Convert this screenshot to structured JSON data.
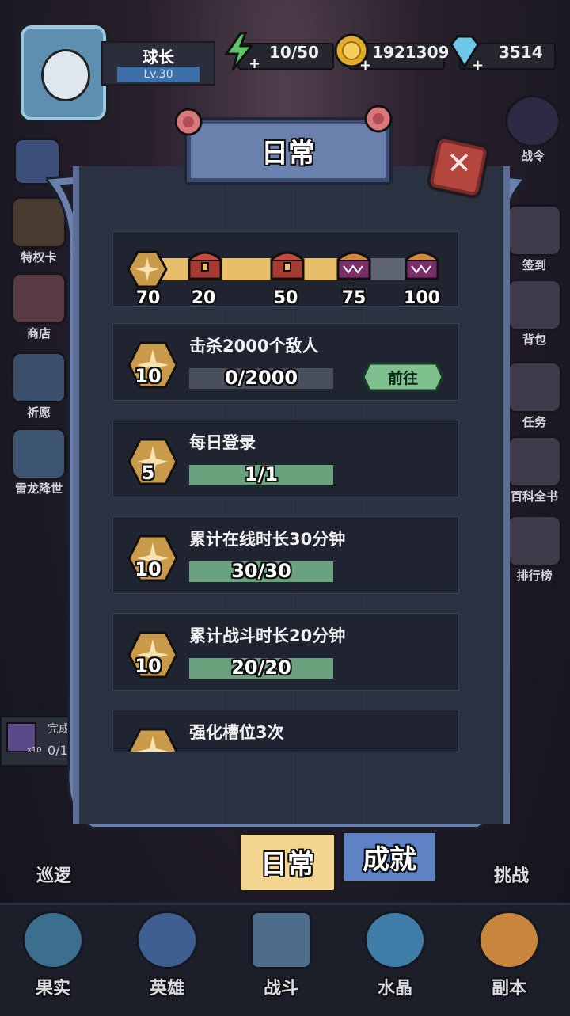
{
  "header": {
    "player_name": "球长",
    "level": "Lv.30",
    "energy": "10/50",
    "gold": "1921309",
    "gems": "3514"
  },
  "left_menu": [
    {
      "label": "特权卡",
      "icon": "card-icon"
    },
    {
      "label": "商店",
      "icon": "shop-icon"
    },
    {
      "label": "祈愿",
      "icon": "wish-icon"
    },
    {
      "label": "雷龙降世",
      "icon": "dragon-icon"
    }
  ],
  "right_menu": [
    {
      "label": "战令",
      "icon": "eye-icon"
    },
    {
      "label": "签到",
      "icon": "signin-icon"
    },
    {
      "label": "背包",
      "icon": "bag-icon"
    },
    {
      "label": "任务",
      "icon": "task-icon"
    },
    {
      "label": "百科全书",
      "icon": "book-icon"
    },
    {
      "label": "排行榜",
      "icon": "rank-icon"
    }
  ],
  "side_quest": {
    "label": "完成",
    "count": "0/1",
    "multiplier": "x10"
  },
  "panel": {
    "title": "日常",
    "close_icon": "close-icon",
    "activity": {
      "current": "70",
      "milestones": [
        "20",
        "50",
        "75",
        "100"
      ],
      "progress_fraction": 0.7
    },
    "tasks": [
      {
        "name": "击杀2000个敌人",
        "reward": "10",
        "progress": "0/2000",
        "fill": 0.0,
        "action": "前往"
      },
      {
        "name": "每日登录",
        "reward": "5",
        "progress": "1/1",
        "fill": 1.0
      },
      {
        "name": "累计在线时长30分钟",
        "reward": "10",
        "progress": "30/30",
        "fill": 1.0
      },
      {
        "name": "累计战斗时长20分钟",
        "reward": "10",
        "progress": "20/20",
        "fill": 1.0
      },
      {
        "name": "强化槽位3次",
        "reward": "",
        "progress": "",
        "fill": 0.0
      }
    ]
  },
  "tabs": {
    "daily": "日常",
    "achievement": "成就"
  },
  "side_bottom": {
    "patrol": "巡逻",
    "challenge": "挑战"
  },
  "nav": [
    "果实",
    "英雄",
    "战斗",
    "水晶",
    "副本"
  ],
  "colors": {
    "accent_gold": "#e8be6a",
    "progress_green": "#6aa27e",
    "panel_blue": "#5c6e95",
    "close_red": "#b5463e",
    "tab_active": "#f2d58e",
    "tab_inactive": "#5f82c4"
  }
}
